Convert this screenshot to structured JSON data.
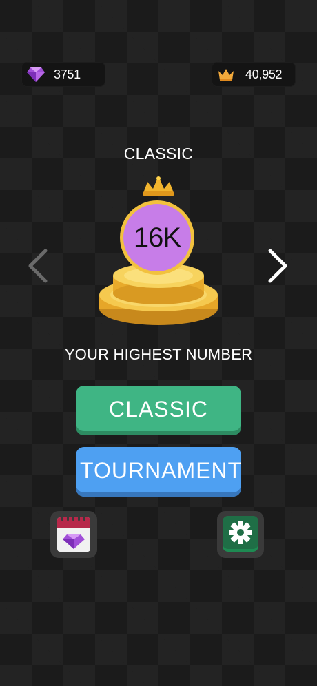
{
  "currency": {
    "gems": "3751",
    "crowns": "40,952"
  },
  "mode": {
    "title": "CLASSIC",
    "best_score": "16K",
    "best_label": "YOUR HIGHEST NUMBER"
  },
  "buttons": {
    "classic": "CLASSIC",
    "tournament": "TOURNAMENT"
  },
  "icons": {
    "gem": "gem-icon",
    "crown": "crown-icon",
    "calendar": "calendar-gem-icon",
    "settings": "gear-icon",
    "prev": "chevron-left-icon",
    "next": "chevron-right-icon"
  },
  "colors": {
    "classic": "#3fb584",
    "tournament": "#4ea0f2",
    "score_circle": "#c77de8",
    "gold": "#f2c13e",
    "settings": "#1e8a52"
  }
}
